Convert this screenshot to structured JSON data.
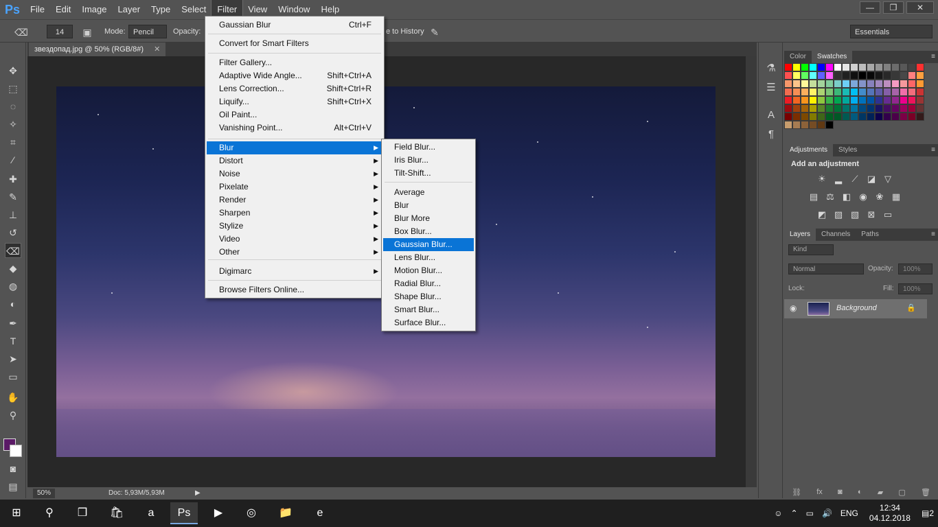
{
  "app": {
    "logo": "Ps",
    "menus": [
      "File",
      "Edit",
      "Image",
      "Layer",
      "Type",
      "Select",
      "Filter",
      "View",
      "Window",
      "Help"
    ],
    "window_controls": {
      "minimize": "—",
      "restore": "❐",
      "close": "✕"
    }
  },
  "options_bar": {
    "brush_size": "14",
    "mode_label": "Mode:",
    "mode_value": "Pencil",
    "opacity_label": "Opacity:",
    "history_label": "e to History",
    "workspace": "Essentials"
  },
  "document": {
    "tab_title": "звездопад.jpg @ 50% (RGB/8#)",
    "close": "✕"
  },
  "status_bar": {
    "zoom": "50%",
    "doc_info": "Doc: 5,93M/5,93M"
  },
  "filter_menu": {
    "last_filter": {
      "label": "Gaussian Blur",
      "shortcut": "Ctrl+F"
    },
    "convert": "Convert for Smart Filters",
    "gallery_items": [
      {
        "label": "Filter Gallery...",
        "shortcut": ""
      },
      {
        "label": "Adaptive Wide Angle...",
        "shortcut": "Shift+Ctrl+A"
      },
      {
        "label": "Lens Correction...",
        "shortcut": "Shift+Ctrl+R"
      },
      {
        "label": "Liquify...",
        "shortcut": "Shift+Ctrl+X"
      },
      {
        "label": "Oil Paint...",
        "shortcut": ""
      },
      {
        "label": "Vanishing Point...",
        "shortcut": "Alt+Ctrl+V"
      }
    ],
    "submenus": [
      "Blur",
      "Distort",
      "Noise",
      "Pixelate",
      "Render",
      "Sharpen",
      "Stylize",
      "Video",
      "Other"
    ],
    "digimarc": "Digimarc",
    "browse": "Browse Filters Online..."
  },
  "blur_submenu": {
    "group1": [
      "Field Blur...",
      "Iris Blur...",
      "Tilt-Shift..."
    ],
    "group2": [
      "Average",
      "Blur",
      "Blur More",
      "Box Blur...",
      "Gaussian Blur...",
      "Lens Blur...",
      "Motion Blur...",
      "Radial Blur...",
      "Shape Blur...",
      "Smart Blur...",
      "Surface Blur..."
    ],
    "highlighted": "Gaussian Blur..."
  },
  "panels": {
    "color_tabs": [
      "Color",
      "Swatches"
    ],
    "adjust_tabs": [
      "Adjustments",
      "Styles"
    ],
    "add_adjustment": "Add an adjustment",
    "layers_tabs": [
      "Layers",
      "Channels",
      "Paths"
    ],
    "kind_label": "Kind",
    "blend_mode": "Normal",
    "opacity_label": "Opacity:",
    "opacity_value": "100%",
    "lock_label": "Lock:",
    "fill_label": "Fill:",
    "fill_value": "100%",
    "layer_name": "Background"
  },
  "colors": {
    "foreground": "#5a1a66",
    "background": "#ffffff",
    "menu_highlight": "#0a74d6"
  },
  "taskbar": {
    "lang": "ENG",
    "time": "12:34",
    "date": "04.12.2018",
    "notifications": "2"
  }
}
